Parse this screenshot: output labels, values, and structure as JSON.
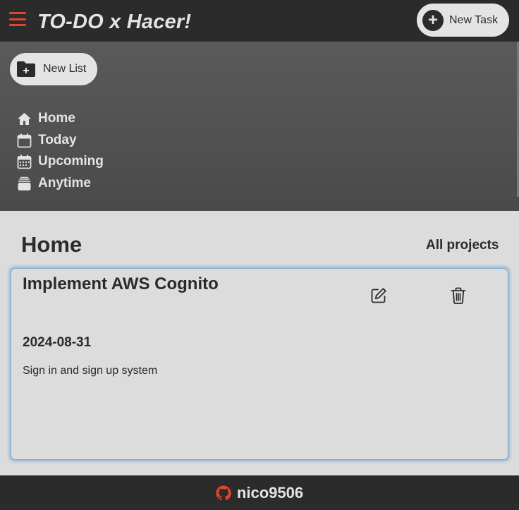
{
  "header": {
    "title": "TO-DO x Hacer!",
    "new_task_label": "New Task",
    "accent_color": "#e0452f"
  },
  "sidebar": {
    "new_list_label": "New List",
    "items": [
      {
        "label": "Home",
        "icon": "home-icon"
      },
      {
        "label": "Today",
        "icon": "calendar-icon"
      },
      {
        "label": "Upcoming",
        "icon": "calendar-grid-icon"
      },
      {
        "label": "Anytime",
        "icon": "stack-icon"
      }
    ]
  },
  "main": {
    "title": "Home",
    "filter_label": "All projects",
    "tasks": [
      {
        "title": "Implement AWS Cognito",
        "date": "2024-08-31",
        "description": "Sign in and sign up system"
      }
    ]
  },
  "footer": {
    "username": "nico9506",
    "icon": "github-icon"
  }
}
